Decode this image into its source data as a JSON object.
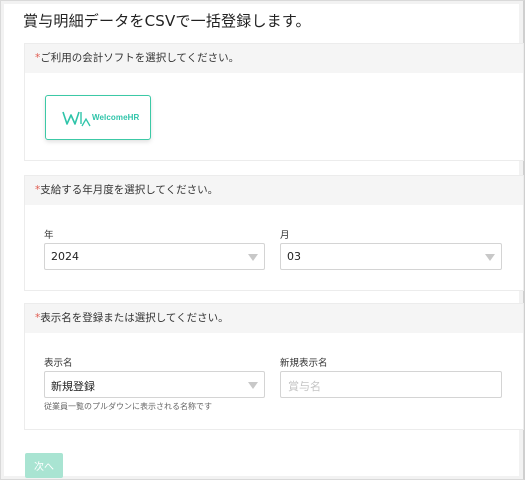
{
  "page": {
    "title": "賞与明細データをCSVで一括登録します。"
  },
  "required_mark": "*",
  "software_section": {
    "heading": "ご利用の会計ソフトを選択してください。",
    "options": [
      {
        "name": "WelcomeHR",
        "logo_icon": "welcomehr-logo-icon",
        "selected": true,
        "accent": "#2ec4a9"
      }
    ]
  },
  "period_section": {
    "heading": "支給する年月度を選択してください。",
    "year": {
      "label": "年",
      "value": "2024"
    },
    "month": {
      "label": "月",
      "value": "03"
    }
  },
  "display_name_section": {
    "heading": "表示名を登録または選択してください。",
    "display_name": {
      "label": "表示名",
      "value": "新規登録",
      "help": "従業員一覧のプルダウンに表示される名称です"
    },
    "new_display_name": {
      "label": "新規表示名",
      "placeholder": "賞与名",
      "value": ""
    }
  },
  "actions": {
    "next_label": "次へ",
    "next_enabled": false,
    "next_color": "#a9e4d2"
  },
  "colors": {
    "accent": "#3cc9a6",
    "required": "#e05a4e",
    "section_header_bg": "#f5f5f5"
  }
}
